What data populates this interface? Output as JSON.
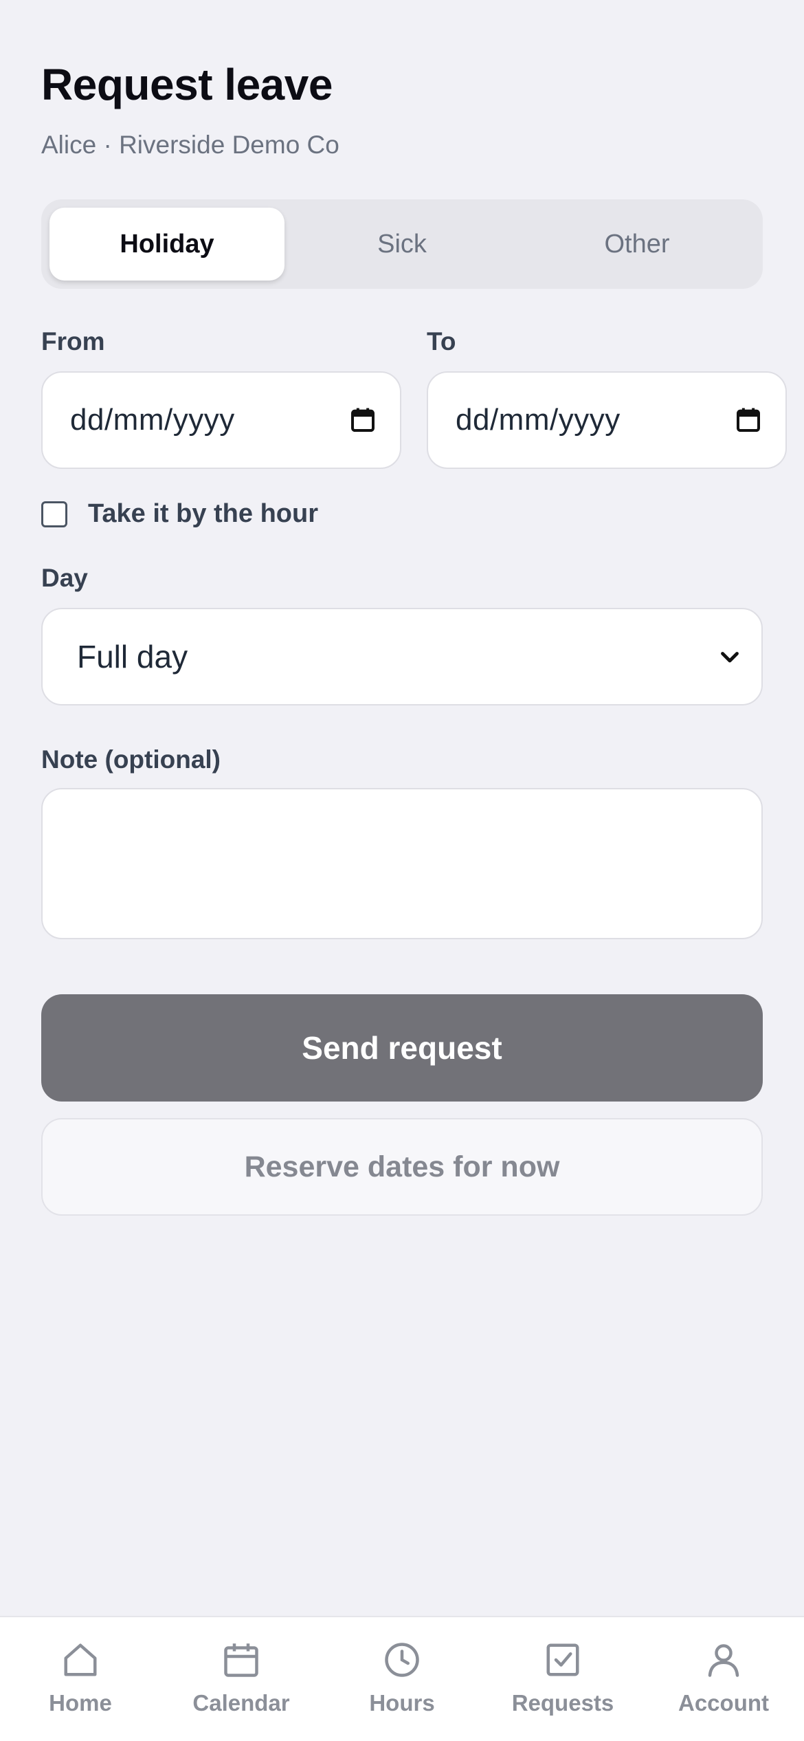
{
  "header": {
    "title": "Request leave",
    "subtitle": "Alice · Riverside Demo Co"
  },
  "leave_type": {
    "options": [
      "Holiday",
      "Sick",
      "Other"
    ],
    "selected": "Holiday"
  },
  "dates": {
    "from_label": "From",
    "to_label": "To",
    "from_placeholder": "dd/mm/yyyy",
    "to_placeholder": "dd/mm/yyyy"
  },
  "by_hour": {
    "label": "Take it by the hour",
    "checked": false
  },
  "day": {
    "label": "Day",
    "value": "Full day"
  },
  "note": {
    "label": "Note (optional)",
    "value": ""
  },
  "actions": {
    "send_label": "Send request",
    "reserve_label": "Reserve dates for now"
  },
  "tabbar": {
    "items": [
      {
        "label": "Home",
        "icon": "home-icon"
      },
      {
        "label": "Calendar",
        "icon": "calendar-icon"
      },
      {
        "label": "Hours",
        "icon": "clock-icon"
      },
      {
        "label": "Requests",
        "icon": "check-square-icon"
      },
      {
        "label": "Account",
        "icon": "person-icon"
      }
    ]
  },
  "colors": {
    "background": "#f1f1f6",
    "primary_button": "#727278",
    "tab_inactive": "#8b8f98"
  }
}
